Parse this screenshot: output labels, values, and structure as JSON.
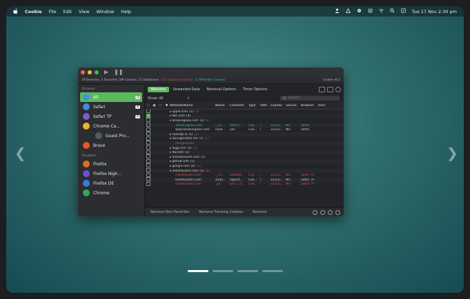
{
  "menubar": {
    "app": "Cookie",
    "items": [
      "File",
      "Edit",
      "View",
      "Window",
      "Help"
    ],
    "datetime": "Tue 17 Nov  2:30 pm"
  },
  "nav": {
    "prev": "❮",
    "next": "❯"
  },
  "window": {
    "status_main": "19 Domains, 5 Favorites | 89 Cookies, 12 Databases",
    "status_tracking": "(14 Tracking Cookies)",
    "status_whitelisted": "(1 Whitelist Cookies)",
    "version": "Cookie v6.2",
    "sidebar": {
      "browsers_header": "Browser",
      "browsers": [
        {
          "label": "All",
          "badge": "3",
          "selected": true,
          "color": "#4a90d9"
        },
        {
          "label": "Safari",
          "badge": "4",
          "color": "#3a8fd6"
        },
        {
          "label": "Safari TP",
          "badge": "1",
          "color": "#7a5bd0"
        },
        {
          "label": "Chrome Ca...",
          "badge": "",
          "color": "#f0b429"
        },
        {
          "label": "Guest Pro...",
          "badge": "",
          "color": "#555a60"
        },
        {
          "label": "Brave",
          "badge": "",
          "color": "#e8552d"
        }
      ],
      "disabled_header": "Disabled",
      "disabled": [
        {
          "label": "Firefox",
          "color": "#e66a1f"
        },
        {
          "label": "Firefox Nigh...",
          "color": "#6b4fd6"
        },
        {
          "label": "Firefox DE",
          "color": "#3a7be0"
        },
        {
          "label": "Chrome",
          "color": "#34a853"
        }
      ]
    },
    "tabs": [
      "Websites",
      "Unwanted Data",
      "Removal Options",
      "Timer Options"
    ],
    "filter": {
      "label": "Show: All",
      "arrow": "⇕",
      "search_placeholder": "Search"
    },
    "columns": [
      "Website/Name",
      "Name",
      "Contents",
      "Type",
      "Path",
      "Expires",
      "Secure",
      "Browser",
      "User"
    ],
    "rows": [
      {
        "site": "apple.com",
        "count": "(3)",
        "count2": "(3)",
        "kind": "domain",
        "fav": false
      },
      {
        "site": "bbc.com",
        "count": "(9)",
        "kind": "domain",
        "fav": true
      },
      {
        "site": "breakingasia.com",
        "count": "(2)",
        "count2": "(1)",
        "kind": "domain",
        "fav": false,
        "open": true
      },
      {
        "site": ".breakingasia.com",
        "name": "__cf...",
        "contents": "d42fcc...",
        "type": "Coo...",
        "path": "/",
        "expires": "15/12/...",
        "secure": "NO",
        "browser": "Safari",
        "kind": "teal"
      },
      {
        "site": "www.breakingasia.com",
        "name": "cook...",
        "contents": "yes",
        "type": "Coo...",
        "path": "/",
        "expires": "22/11/...",
        "secure": "NO",
        "browser": "Safari",
        "kind": "child"
      },
      {
        "site": "coincap.io",
        "count": "(1)",
        "count2": "(1)",
        "kind": "domain"
      },
      {
        "site": "daringfireball.net",
        "count": "(1)",
        "count2": "(1)",
        "kind": "domain"
      },
      {
        "site": "dangpopular",
        "kind": "dim"
      },
      {
        "site": "digg.com",
        "count": "(4)",
        "count2": "(2)",
        "kind": "domain"
      },
      {
        "site": "dw.com",
        "count": "(3)",
        "kind": "domain"
      },
      {
        "site": "fontawesome.com",
        "count": "(1)",
        "kind": "domain"
      },
      {
        "site": "github.com",
        "count": "(1)",
        "kind": "domain"
      },
      {
        "site": "google.com",
        "count": "(6)",
        "count2": "(1)",
        "kind": "domain"
      },
      {
        "site": "indiehackers.com",
        "count": "(5)",
        "count2": "(3)",
        "kind": "domain",
        "open": true
      },
      {
        "site": "indiehackers.com",
        "name": "__cf...",
        "contents": "d6b089...",
        "type": "Coo...",
        "path": "/",
        "expires": "15/12/...",
        "secure": "NO",
        "browser": "Safari TP",
        "kind": "redrow"
      },
      {
        "site": "indiehackers.com",
        "name": "ampl...",
        "contents": "eyJkZX...",
        "type": "Coo...",
        "path": "/",
        "expires": "22/11/...",
        "secure": "NO",
        "browser": "Safari TP",
        "kind": "child"
      },
      {
        "site": "indiehackers.com",
        "name": "_ga",
        "contents": "GA1.2.4...",
        "type": "Coo...",
        "path": "/",
        "expires": "22/11/...",
        "secure": "NO",
        "browser": "Safari TP",
        "kind": "redrow"
      }
    ],
    "bottom": [
      "Remove Non-Favorites",
      "Remove Tracking Cookies",
      "Remove"
    ]
  },
  "colors": {
    "accent": "#5cb85c",
    "tracking": "#d9534f",
    "whitelist": "#43b3b8"
  }
}
